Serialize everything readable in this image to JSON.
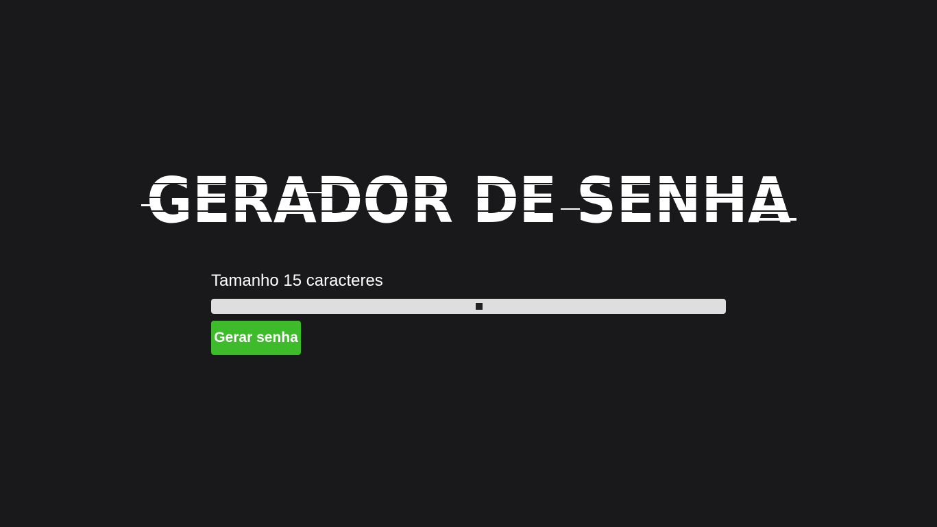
{
  "header": {
    "title": "GERADOR DE SENHA"
  },
  "generator": {
    "size_label": "Tamanho 15 caracteres",
    "slider_value_fraction": 0.52,
    "generate_label": "Gerar senha"
  },
  "colors": {
    "background": "#19191b",
    "title": "#ffffff",
    "slider_track": "#dedede",
    "slider_thumb": "#222222",
    "button": "#3dbb2a"
  }
}
